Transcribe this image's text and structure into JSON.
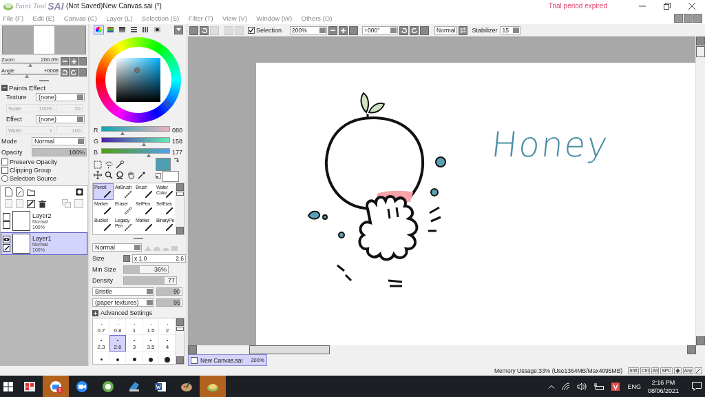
{
  "app": {
    "logo_small": "Paint Tool",
    "logo_brand": "SAI",
    "document_title": "(Not Saved)New Canvas.sai (*)",
    "notice": "Trial period expired"
  },
  "menu": [
    "File (F)",
    "Edit (E)",
    "Canvas (C)",
    "Layer (L)",
    "Selection (S)",
    "Filter (T)",
    "View (V)",
    "Window (W)",
    "Others (O)"
  ],
  "navigator": {
    "zoom": {
      "label": "Zoom",
      "value": "200.0%",
      "level": 0.5
    },
    "angle": {
      "label": "Angle",
      "value": "+0008",
      "level": 0.45
    }
  },
  "paints_effect": {
    "title": "Paints Effect",
    "expanded": true,
    "rows": [
      {
        "kind": "select",
        "label": "Texture",
        "value": "(none)"
      },
      {
        "kind": "pair",
        "label": "Scale",
        "value": "100%",
        "number": "20"
      },
      {
        "kind": "select",
        "label": "Effect",
        "value": "(none)"
      },
      {
        "kind": "pair",
        "label": "Width",
        "value": "1",
        "number": "100"
      }
    ]
  },
  "layer_props": {
    "mode_label": "Mode",
    "mode": "Normal",
    "opacity": {
      "label": "Opacity",
      "value": "100%",
      "level": 1
    },
    "options": [
      {
        "kind": "checkbox",
        "label": "Preserve Opacity",
        "checked": false
      },
      {
        "kind": "checkbox",
        "label": "Clipping Group",
        "checked": false
      },
      {
        "kind": "radio",
        "label": "Selection Source",
        "checked": false
      }
    ]
  },
  "layers": [
    {
      "name": "Layer2",
      "mode": "Normal",
      "opacity": "100%",
      "selected": false,
      "visible": false
    },
    {
      "name": "Layer1",
      "mode": "Normal",
      "opacity": "100%",
      "selected": true,
      "visible": true
    }
  ],
  "color": {
    "tabs": [
      {
        "kind": "wheel",
        "selected": true
      },
      {
        "kind": "rgb",
        "selected": false
      },
      {
        "kind": "hsv",
        "selected": false
      },
      {
        "kind": "scratch",
        "selected": false
      },
      {
        "kind": "swatch",
        "selected": false
      },
      {
        "kind": "viewer",
        "selected": false
      }
    ],
    "channels": [
      {
        "name": "R",
        "value": "080",
        "level": 0.31
      },
      {
        "name": "G",
        "value": "158",
        "level": 0.62
      },
      {
        "name": "B",
        "value": "177",
        "level": 0.69
      }
    ]
  },
  "tools": [
    {
      "label": "Pencil",
      "selected": true
    },
    {
      "label": "AirBrush",
      "selected": false
    },
    {
      "label": "Brush",
      "selected": false
    },
    {
      "label": "Water Color",
      "selected": false
    },
    {
      "label": "Marker",
      "selected": false
    },
    {
      "label": "Eraser",
      "selected": false
    },
    {
      "label": "SelPen",
      "selected": false
    },
    {
      "label": "SelEras",
      "selected": false
    },
    {
      "label": "Bucket",
      "selected": false
    },
    {
      "label": "Legacy Pen",
      "selected": false
    },
    {
      "label": "Marker",
      "selected": false
    },
    {
      "label": "BinaryPe",
      "selected": false
    }
  ],
  "brush": {
    "blend_mode": "Normal",
    "size_label": "Size",
    "size_multiplier": "x 1.0",
    "size": "2.6",
    "min_size": {
      "label": "Min Size",
      "value": "36%",
      "level": 0.36
    },
    "density": {
      "label": "Density",
      "value": "77",
      "level": 0.77
    },
    "shape": {
      "value": "Bristle",
      "number": "90",
      "level": 0.9
    },
    "texture": {
      "value": "(paper textures)",
      "number": "95",
      "level": 0.95
    },
    "advanced": "Advanced Settings"
  },
  "brush_sizes": [
    {
      "label": "0.7",
      "selected": false
    },
    {
      "label": "0.8",
      "selected": false
    },
    {
      "label": "1",
      "selected": false
    },
    {
      "label": "1.5",
      "selected": false
    },
    {
      "label": "2",
      "selected": false
    },
    {
      "label": "2.3",
      "selected": false
    },
    {
      "label": "2.6",
      "selected": true
    },
    {
      "label": "3",
      "selected": false
    },
    {
      "label": "3.5",
      "selected": false
    },
    {
      "label": "4",
      "selected": false
    }
  ],
  "toolbar": {
    "selection_label": "Selection",
    "selection_checked": true,
    "zoom": "200%",
    "angle": "+000°",
    "blend": "Normal",
    "stabilizer_label": "Stabilizer",
    "stabilizer": "15"
  },
  "canvas": {
    "handwriting": "Honey"
  },
  "canvas_tab": {
    "name": "New Canvas.sai",
    "zoom": "200%"
  },
  "status": {
    "memory": "Memory Ussage:33% (Use1364MB/Max4095MB)",
    "keys": [
      "Shft",
      "Ctrl",
      "Alt",
      "SPC",
      "Any"
    ]
  },
  "taskbar": {
    "badge": "1",
    "language": "ENG",
    "time": "2:16 PM",
    "date": "08/06/2021"
  }
}
